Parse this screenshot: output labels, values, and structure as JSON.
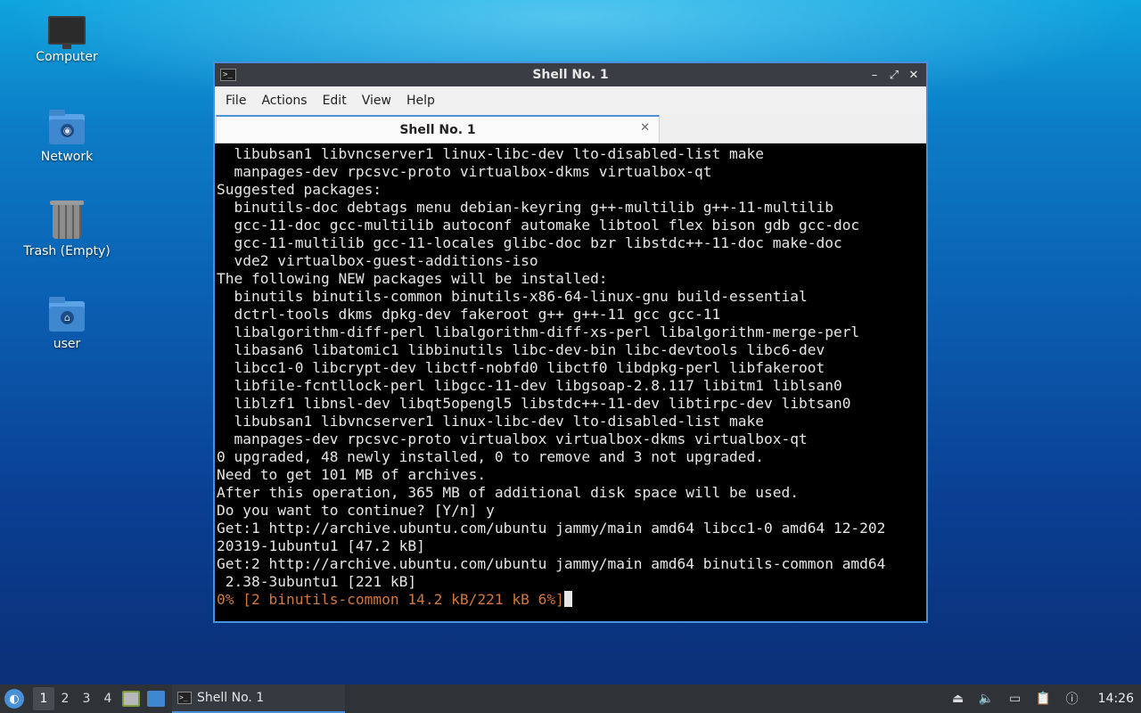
{
  "desktop": {
    "icons": [
      {
        "label": "Computer"
      },
      {
        "label": "Network"
      },
      {
        "label": "Trash (Empty)"
      },
      {
        "label": "user"
      }
    ]
  },
  "window": {
    "title": "Shell No. 1",
    "controls": {
      "minimize": "–",
      "maximize": "⤢",
      "close": "✕"
    },
    "menu": [
      "File",
      "Actions",
      "Edit",
      "View",
      "Help"
    ],
    "tab": {
      "label": "Shell No. 1",
      "close": "✕"
    },
    "terminal": {
      "lines": [
        "  libubsan1 libvncserver1 linux-libc-dev lto-disabled-list make",
        "  manpages-dev rpcsvc-proto virtualbox-dkms virtualbox-qt",
        "Suggested packages:",
        "  binutils-doc debtags menu debian-keyring g++-multilib g++-11-multilib",
        "  gcc-11-doc gcc-multilib autoconf automake libtool flex bison gdb gcc-doc",
        "  gcc-11-multilib gcc-11-locales glibc-doc bzr libstdc++-11-doc make-doc",
        "  vde2 virtualbox-guest-additions-iso",
        "The following NEW packages will be installed:",
        "  binutils binutils-common binutils-x86-64-linux-gnu build-essential",
        "  dctrl-tools dkms dpkg-dev fakeroot g++ g++-11 gcc gcc-11",
        "  libalgorithm-diff-perl libalgorithm-diff-xs-perl libalgorithm-merge-perl",
        "  libasan6 libatomic1 libbinutils libc-dev-bin libc-devtools libc6-dev",
        "  libcc1-0 libcrypt-dev libctf-nobfd0 libctf0 libdpkg-perl libfakeroot",
        "  libfile-fcntllock-perl libgcc-11-dev libgsoap-2.8.117 libitm1 liblsan0",
        "  liblzf1 libnsl-dev libqt5opengl5 libstdc++-11-dev libtirpc-dev libtsan0",
        "  libubsan1 libvncserver1 linux-libc-dev lto-disabled-list make",
        "  manpages-dev rpcsvc-proto virtualbox virtualbox-dkms virtualbox-qt",
        "0 upgraded, 48 newly installed, 0 to remove and 3 not upgraded.",
        "Need to get 101 MB of archives.",
        "After this operation, 365 MB of additional disk space will be used.",
        "Do you want to continue? [Y/n] y",
        "Get:1 http://archive.ubuntu.com/ubuntu jammy/main amd64 libcc1-0 amd64 12-202",
        "20319-1ubuntu1 [47.2 kB]",
        "Get:2 http://archive.ubuntu.com/ubuntu jammy/main amd64 binutils-common amd64",
        " 2.38-3ubuntu1 [221 kB]"
      ],
      "progress_line": "0% [2 binutils-common 14.2 kB/221 kB 6%]",
      "progress_color": "#d0783c"
    }
  },
  "taskbar": {
    "start_icon": "lubuntu-logo-icon",
    "workspaces": [
      "1",
      "2",
      "3",
      "4"
    ],
    "task": {
      "label": "Shell No. 1"
    },
    "clock": "14:26"
  },
  "colors": {
    "accent": "#4a90d9",
    "terminal_bg": "#000000",
    "terminal_fg": "#e6e6e6",
    "taskbar_bg": "#2f3338"
  }
}
